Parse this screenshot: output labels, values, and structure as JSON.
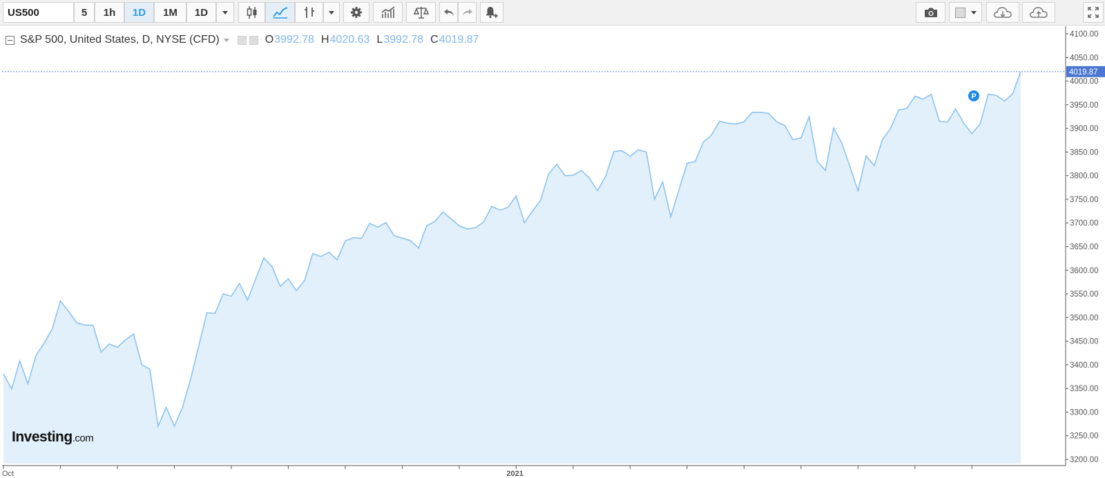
{
  "toolbar": {
    "symbol": "US500",
    "intervals": [
      "5",
      "1h",
      "1D",
      "1M",
      "1D"
    ],
    "active_interval_index": 2,
    "icons": [
      "candlestick-icon",
      "area-chart-icon",
      "bar-chart-icon",
      "settings-icon",
      "indicators-icon",
      "compare-icon",
      "undo-icon",
      "redo-icon",
      "alert-icon",
      "camera-icon",
      "color-box-icon",
      "cloud-download-icon",
      "cloud-upload-icon",
      "fullscreen-icon"
    ]
  },
  "legend": {
    "series": "S&P 500, United States, D, NYSE (CFD)",
    "o_label": "O",
    "o": "3992.78",
    "h_label": "H",
    "h": "4020.63",
    "l_label": "L",
    "l": "3992.78",
    "c_label": "C",
    "c": "4019.87"
  },
  "logo": {
    "brand": "Investing",
    "suffix": ".com"
  },
  "marker_label": "P",
  "colors": {
    "line": "#8ec2ee",
    "fill": "#e1f0fa",
    "last_price_bg": "#4b77d1",
    "marker": "#1e88e5"
  },
  "chart_data": {
    "type": "area",
    "title": "S&P 500, United States, D, NYSE (CFD)",
    "xlabel": "",
    "ylabel": "",
    "ylim": [
      3190,
      4115
    ],
    "yticks": [
      4100,
      4050,
      4000,
      3950,
      3900,
      3850,
      3800,
      3750,
      3700,
      3650,
      3600,
      3550,
      3500,
      3450,
      3400,
      3350,
      3300,
      3250,
      3200
    ],
    "x_tick_labels": [
      {
        "label": "Oct",
        "index": 0
      },
      {
        "label": "2021",
        "index": 62
      }
    ],
    "last_price": "4019.87",
    "grid": false,
    "legend": "top-left",
    "series": [
      {
        "values": [
          3381,
          3349,
          3408,
          3360,
          3420,
          3446,
          3476,
          3535,
          3513,
          3489,
          3484,
          3484,
          3427,
          3444,
          3437,
          3453,
          3465,
          3400,
          3391,
          3270,
          3310,
          3270,
          3310,
          3370,
          3440,
          3510,
          3509,
          3550,
          3545,
          3572,
          3537,
          3582,
          3626,
          3608,
          3566,
          3582,
          3557,
          3578,
          3635,
          3629,
          3638,
          3622,
          3662,
          3669,
          3667,
          3699,
          3691,
          3701,
          3673,
          3668,
          3663,
          3647,
          3694,
          3703,
          3723,
          3709,
          3694,
          3687,
          3690,
          3702,
          3735,
          3727,
          3733,
          3757,
          3700,
          3725,
          3748,
          3804,
          3824,
          3800,
          3801,
          3811,
          3795,
          3768,
          3799,
          3851,
          3853,
          3841,
          3855,
          3850,
          3750,
          3787,
          3713,
          3770,
          3826,
          3830,
          3871,
          3886,
          3915,
          3911,
          3909,
          3914,
          3934,
          3934,
          3932,
          3914,
          3906,
          3876,
          3880,
          3925,
          3830,
          3811,
          3901,
          3869,
          3820,
          3768,
          3842,
          3821,
          3876,
          3900,
          3939,
          3942,
          3968,
          3962,
          3972,
          3915,
          3913,
          3941,
          3911,
          3889,
          3909,
          3972,
          3970,
          3958,
          3973,
          4020
        ]
      }
    ]
  }
}
